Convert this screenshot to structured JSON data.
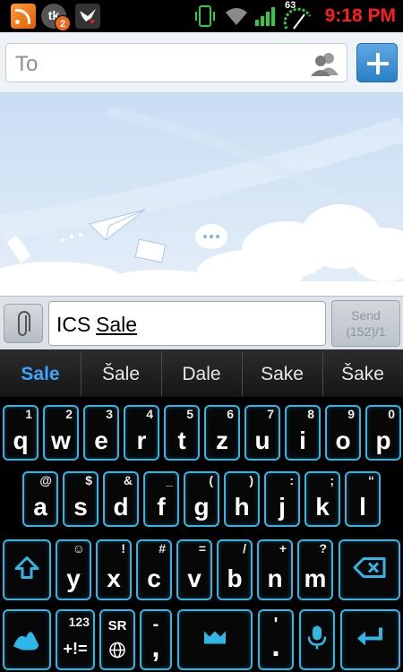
{
  "status_bar": {
    "icons": [
      "rss-icon",
      "tk-app-icon",
      "bird-app-icon",
      "phone-vibrate-icon",
      "wifi-icon",
      "signal-icon",
      "battery-icon"
    ],
    "tk_label": "tk",
    "notification_badge": "2",
    "battery_percent": "63",
    "time": "9:18 PM",
    "time_color": "#ff1c1c"
  },
  "recipient": {
    "placeholder": "To",
    "contacts_icon": "contacts-icon",
    "add_icon": "plus-icon"
  },
  "compose": {
    "attach_icon": "paperclip-icon",
    "text_prefix": "ICS ",
    "text_composing": "Sale",
    "send_label": "Send",
    "char_count": "(152)/1"
  },
  "suggestions": [
    {
      "label": "Sale",
      "selected": true
    },
    {
      "label": "Šale",
      "selected": false
    },
    {
      "label": "Dale",
      "selected": false
    },
    {
      "label": "Sake",
      "selected": false
    },
    {
      "label": "Šake",
      "selected": false
    }
  ],
  "keyboard": {
    "accent_color": "#2fb7e8",
    "row1": [
      {
        "main": "q",
        "sub": "1"
      },
      {
        "main": "w",
        "sub": "2"
      },
      {
        "main": "e",
        "sub": "3"
      },
      {
        "main": "r",
        "sub": "4"
      },
      {
        "main": "t",
        "sub": "5"
      },
      {
        "main": "z",
        "sub": "6"
      },
      {
        "main": "u",
        "sub": "7"
      },
      {
        "main": "i",
        "sub": "8"
      },
      {
        "main": "o",
        "sub": "9"
      },
      {
        "main": "p",
        "sub": "0"
      }
    ],
    "row2": [
      {
        "main": "a",
        "sub": "@"
      },
      {
        "main": "s",
        "sub": "$"
      },
      {
        "main": "d",
        "sub": "&"
      },
      {
        "main": "f",
        "sub": "_"
      },
      {
        "main": "g",
        "sub": "("
      },
      {
        "main": "h",
        "sub": ")"
      },
      {
        "main": "j",
        "sub": ":"
      },
      {
        "main": "k",
        "sub": ";"
      },
      {
        "main": "l",
        "sub": "“"
      }
    ],
    "row3": [
      {
        "main": "y",
        "sub": "☺"
      },
      {
        "main": "x",
        "sub": "!"
      },
      {
        "main": "c",
        "sub": "#"
      },
      {
        "main": "v",
        "sub": "="
      },
      {
        "main": "b",
        "sub": "/"
      },
      {
        "main": "n",
        "sub": "+"
      },
      {
        "main": "m",
        "sub": "?"
      }
    ],
    "shift_icon": "shift-arrow-icon",
    "backspace_icon": "backspace-icon",
    "swype_icon": "swype-hand-icon",
    "symbols_top": "123",
    "symbols_bottom": "+!=",
    "language_label": "SR",
    "globe_icon": "globe-icon",
    "comma_sub": "-",
    "comma_main": ",",
    "space_icon": "space-bar-icon",
    "period_sub": "'",
    "period_main": ".",
    "mic_icon": "microphone-icon",
    "enter_icon": "enter-icon"
  }
}
